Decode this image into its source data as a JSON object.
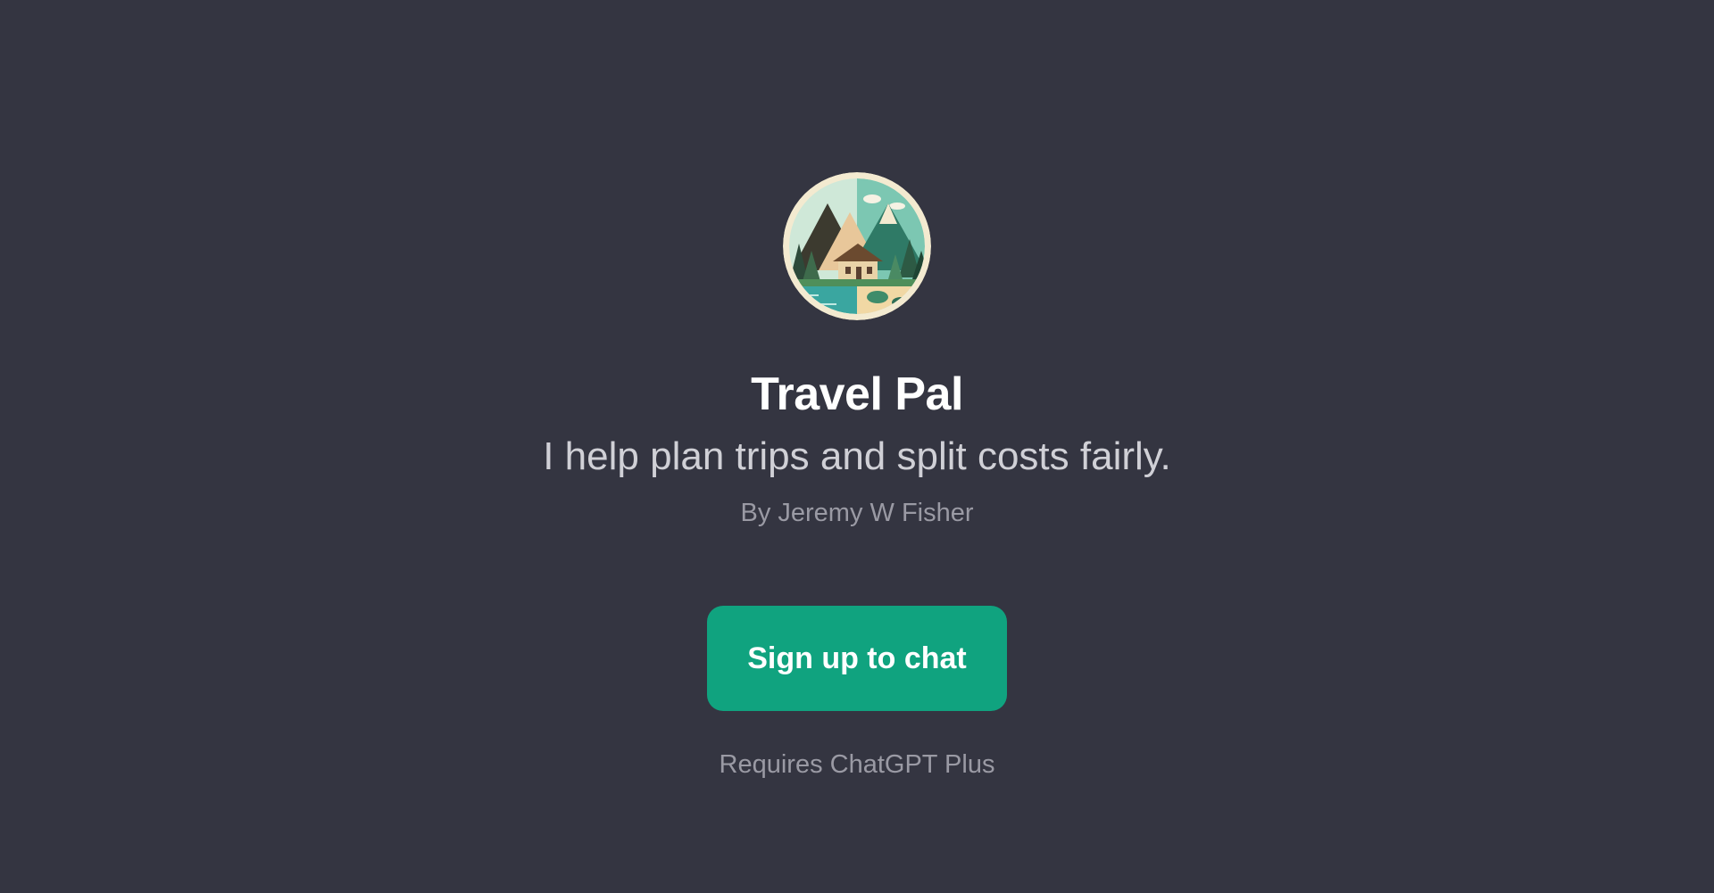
{
  "gpt": {
    "avatar_icon": "travel-landscape-icon",
    "name": "Travel Pal",
    "description": "I help plan trips and split costs fairly.",
    "author": "By Jeremy W Fisher"
  },
  "actions": {
    "signup_label": "Sign up to chat",
    "requirement_note": "Requires ChatGPT Plus"
  },
  "colors": {
    "background": "#343541",
    "button": "#10a37f",
    "title": "#ffffff",
    "muted": "#9a9aa4"
  }
}
